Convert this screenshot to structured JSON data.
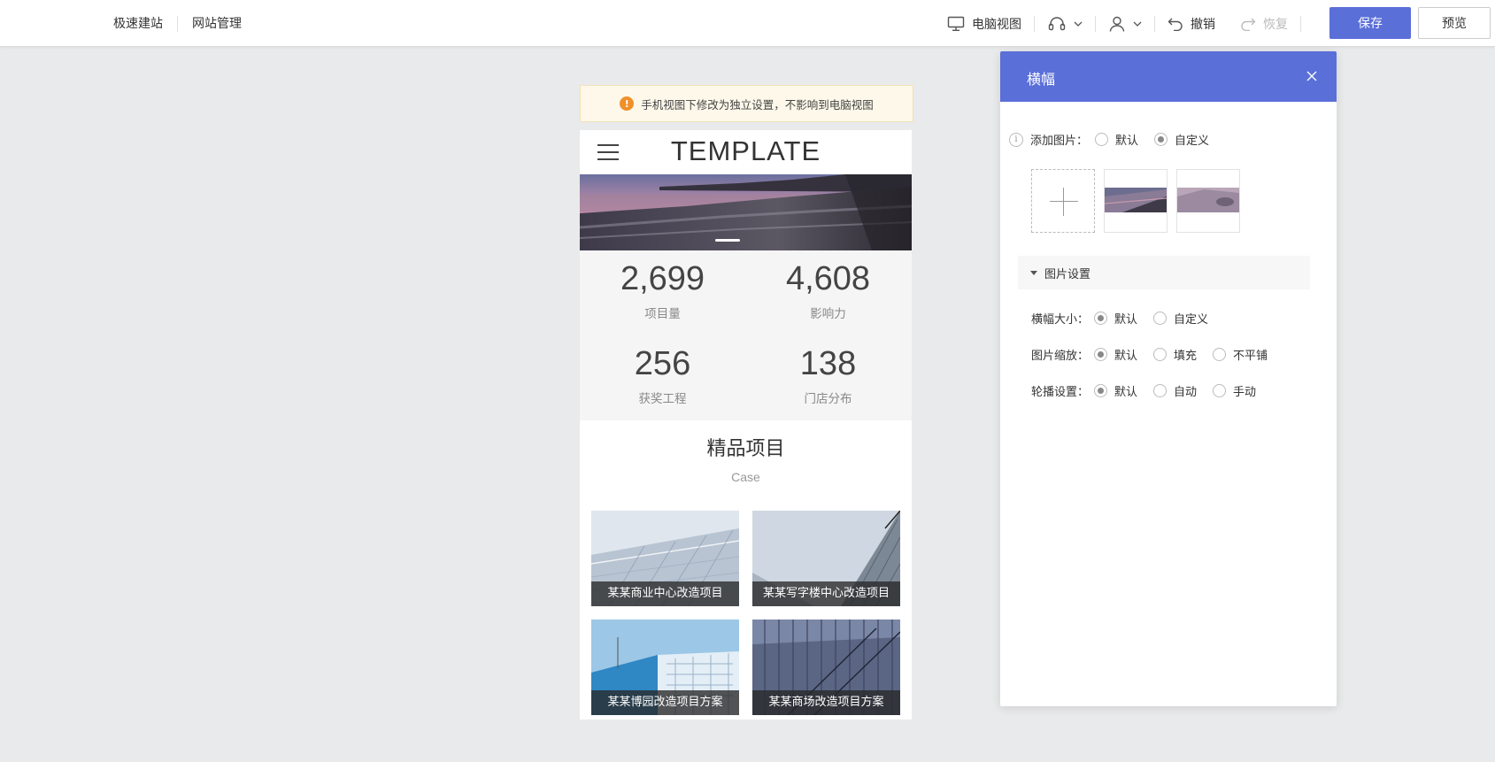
{
  "topbar": {
    "left_items": [
      "极速建站",
      "网站管理"
    ],
    "desktop_view": "电脑视图",
    "undo": "撤销",
    "redo": "恢复",
    "save": "保存",
    "preview": "预览"
  },
  "notice": "手机视图下修改为独立设置，不影响到电脑视图",
  "phone": {
    "brand": "TEMPLATE",
    "stats": [
      {
        "value": "2,699",
        "label": "项目量"
      },
      {
        "value": "4,608",
        "label": "影响力"
      },
      {
        "value": "256",
        "label": "获奖工程"
      },
      {
        "value": "138",
        "label": "门店分布"
      }
    ],
    "section_title": "精品项目",
    "section_sub": "Case",
    "projects": [
      {
        "caption": "某某商业中心改造项目"
      },
      {
        "caption": "某某写字楼中心改造项目"
      },
      {
        "caption": "某某博园改造项目方案"
      },
      {
        "caption": "某某商场改造项目方案"
      }
    ]
  },
  "panel": {
    "title": "横幅",
    "add_image_label": "添加图片：",
    "add_image_options": [
      "默认",
      "自定义"
    ],
    "add_image_selected": 1,
    "image_settings": "图片设置",
    "size_label": "横幅大小：",
    "size_options": [
      "默认",
      "自定义"
    ],
    "scale_label": "图片缩放：",
    "scale_options": [
      "默认",
      "填充",
      "不平铺"
    ],
    "carousel_label": "轮播设置：",
    "carousel_options": [
      "默认",
      "自动",
      "手动"
    ]
  },
  "colors": {
    "accent": "#5a6fd8",
    "notice_icon": "#f0902a"
  }
}
